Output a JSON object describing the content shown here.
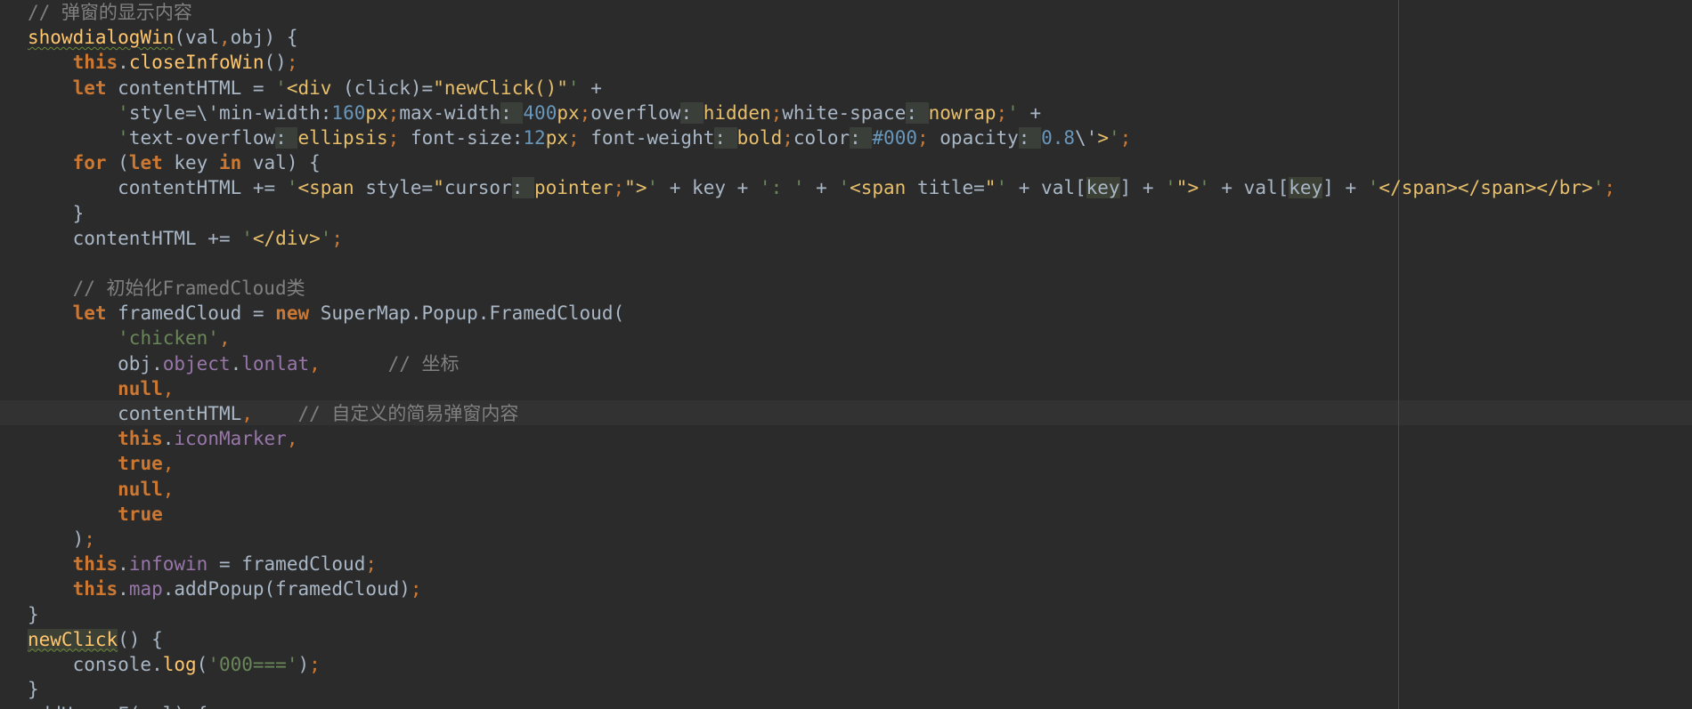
{
  "editor": {
    "lines": [
      {
        "indent": "",
        "segments": [
          {
            "t": "// 弹窗的显示内容",
            "c": "cmt"
          }
        ]
      },
      {
        "indent": "",
        "segments": [
          {
            "t": "showdialogWin",
            "c": "fn squig"
          },
          {
            "t": "(val",
            "c": "plain"
          },
          {
            "t": ",",
            "c": "pun"
          },
          {
            "t": "obj) {",
            "c": "plain"
          }
        ]
      },
      {
        "indent": "    ",
        "segments": [
          {
            "t": "this",
            "c": "kw"
          },
          {
            "t": ".",
            "c": "plain"
          },
          {
            "t": "closeInfoWin",
            "c": "fn"
          },
          {
            "t": "()",
            "c": "plain"
          },
          {
            "t": ";",
            "c": "pun"
          }
        ]
      },
      {
        "indent": "    ",
        "segments": [
          {
            "t": "let ",
            "c": "kw"
          },
          {
            "t": "contentHTML = ",
            "c": "plain"
          },
          {
            "t": "'",
            "c": "str"
          },
          {
            "t": "<div ",
            "c": "strb"
          },
          {
            "t": "(click)=",
            "c": "plain"
          },
          {
            "t": "\"newClick()\"",
            "c": "strb"
          },
          {
            "t": "' ",
            "c": "str"
          },
          {
            "t": "+",
            "c": "plain"
          }
        ]
      },
      {
        "indent": "        ",
        "segments": [
          {
            "t": "'",
            "c": "str"
          },
          {
            "t": "style=\\'",
            "c": "plain"
          },
          {
            "t": "min-width",
            "c": "plain"
          },
          {
            "t": ":",
            "c": "plain"
          },
          {
            "t": "160",
            "c": "num"
          },
          {
            "t": "px",
            "c": "strb"
          },
          {
            "t": ";",
            "c": "pun"
          },
          {
            "t": "max-width",
            "c": "plain"
          },
          {
            "t": ": ",
            "c": "plain hl"
          },
          {
            "t": "400",
            "c": "num"
          },
          {
            "t": "px",
            "c": "strb"
          },
          {
            "t": ";",
            "c": "pun"
          },
          {
            "t": "overflow",
            "c": "plain"
          },
          {
            "t": ": ",
            "c": "plain hl"
          },
          {
            "t": "hidden",
            "c": "strb"
          },
          {
            "t": ";",
            "c": "pun"
          },
          {
            "t": "white-space",
            "c": "plain"
          },
          {
            "t": ": ",
            "c": "plain hl"
          },
          {
            "t": "nowrap",
            "c": "strb"
          },
          {
            "t": ";",
            "c": "pun"
          },
          {
            "t": "' ",
            "c": "str"
          },
          {
            "t": "+",
            "c": "plain"
          }
        ]
      },
      {
        "indent": "        ",
        "segments": [
          {
            "t": "'",
            "c": "str"
          },
          {
            "t": "text-overflow",
            "c": "plain"
          },
          {
            "t": ": ",
            "c": "plain hl"
          },
          {
            "t": "ellipsis",
            "c": "strb"
          },
          {
            "t": "; ",
            "c": "pun"
          },
          {
            "t": "font-size",
            "c": "plain"
          },
          {
            "t": ":",
            "c": "plain"
          },
          {
            "t": "12",
            "c": "num"
          },
          {
            "t": "px",
            "c": "strb"
          },
          {
            "t": "; ",
            "c": "pun"
          },
          {
            "t": "font-weight",
            "c": "plain"
          },
          {
            "t": ": ",
            "c": "plain hl"
          },
          {
            "t": "bold",
            "c": "strb"
          },
          {
            "t": ";",
            "c": "pun"
          },
          {
            "t": "color",
            "c": "plain"
          },
          {
            "t": ": ",
            "c": "plain hl"
          },
          {
            "t": "#000",
            "c": "num"
          },
          {
            "t": "; ",
            "c": "pun"
          },
          {
            "t": "opacity",
            "c": "plain"
          },
          {
            "t": ": ",
            "c": "plain hl"
          },
          {
            "t": "0.8",
            "c": "num"
          },
          {
            "t": "\\'",
            "c": "plain"
          },
          {
            "t": ">",
            "c": "strb"
          },
          {
            "t": "'",
            "c": "str"
          },
          {
            "t": ";",
            "c": "pun"
          }
        ]
      },
      {
        "indent": "    ",
        "segments": [
          {
            "t": "for ",
            "c": "kw"
          },
          {
            "t": "(",
            "c": "plain"
          },
          {
            "t": "let ",
            "c": "kw"
          },
          {
            "t": "key ",
            "c": "plain"
          },
          {
            "t": "in ",
            "c": "kw"
          },
          {
            "t": "val) {",
            "c": "plain"
          }
        ]
      },
      {
        "indent": "        ",
        "segments": [
          {
            "t": "contentHTML += ",
            "c": "plain"
          },
          {
            "t": "'",
            "c": "str"
          },
          {
            "t": "<span ",
            "c": "strb"
          },
          {
            "t": "style=",
            "c": "plain"
          },
          {
            "t": "\"",
            "c": "strb"
          },
          {
            "t": "cursor",
            "c": "plain"
          },
          {
            "t": ": ",
            "c": "plain hl"
          },
          {
            "t": "pointer",
            "c": "strb"
          },
          {
            "t": ";",
            "c": "pun"
          },
          {
            "t": "\">",
            "c": "strb"
          },
          {
            "t": "' ",
            "c": "str"
          },
          {
            "t": "+ key + ",
            "c": "plain"
          },
          {
            "t": "': '",
            "c": "str"
          },
          {
            "t": " + ",
            "c": "plain"
          },
          {
            "t": "'",
            "c": "str"
          },
          {
            "t": "<span ",
            "c": "strb"
          },
          {
            "t": "title=",
            "c": "plain"
          },
          {
            "t": "\"",
            "c": "strb"
          },
          {
            "t": "' ",
            "c": "str"
          },
          {
            "t": "+ val[",
            "c": "plain"
          },
          {
            "t": "key",
            "c": "plain usage"
          },
          {
            "t": "] + ",
            "c": "plain"
          },
          {
            "t": "'",
            "c": "str"
          },
          {
            "t": "\">",
            "c": "strb"
          },
          {
            "t": "' ",
            "c": "str"
          },
          {
            "t": "+ val[",
            "c": "plain"
          },
          {
            "t": "key",
            "c": "plain usage"
          },
          {
            "t": "] + ",
            "c": "plain"
          },
          {
            "t": "'",
            "c": "str"
          },
          {
            "t": "</span></span></br>",
            "c": "strb"
          },
          {
            "t": "'",
            "c": "str"
          },
          {
            "t": ";",
            "c": "pun"
          }
        ]
      },
      {
        "indent": "    ",
        "segments": [
          {
            "t": "}",
            "c": "plain"
          }
        ]
      },
      {
        "indent": "    ",
        "segments": [
          {
            "t": "contentHTML += ",
            "c": "plain"
          },
          {
            "t": "'",
            "c": "str"
          },
          {
            "t": "</div>",
            "c": "strb"
          },
          {
            "t": "'",
            "c": "str"
          },
          {
            "t": ";",
            "c": "pun"
          }
        ]
      },
      {
        "indent": "",
        "segments": []
      },
      {
        "indent": "    ",
        "segments": [
          {
            "t": "// 初始化FramedCloud类",
            "c": "cmt"
          }
        ]
      },
      {
        "indent": "    ",
        "segments": [
          {
            "t": "let ",
            "c": "kw"
          },
          {
            "t": "framedCloud = ",
            "c": "plain"
          },
          {
            "t": "new ",
            "c": "kw"
          },
          {
            "t": "SuperMap.Popup.FramedCloud(",
            "c": "plain"
          }
        ]
      },
      {
        "indent": "        ",
        "segments": [
          {
            "t": "'chicken'",
            "c": "str"
          },
          {
            "t": ",",
            "c": "pun"
          }
        ]
      },
      {
        "indent": "        ",
        "segments": [
          {
            "t": "obj.",
            "c": "plain"
          },
          {
            "t": "object",
            "c": "prop"
          },
          {
            "t": ".",
            "c": "plain"
          },
          {
            "t": "lonlat",
            "c": "prop"
          },
          {
            "t": ",      ",
            "c": "pun"
          },
          {
            "t": "// 坐标",
            "c": "cmt"
          }
        ]
      },
      {
        "indent": "        ",
        "segments": [
          {
            "t": "null",
            "c": "kw"
          },
          {
            "t": ",",
            "c": "pun"
          }
        ]
      },
      {
        "indent": "        ",
        "segments": [
          {
            "t": "contentHTML",
            "c": "plain"
          },
          {
            "t": ",    ",
            "c": "pun"
          },
          {
            "t": "// 自定义的简易弹窗内容",
            "c": "cmt"
          }
        ]
      },
      {
        "indent": "        ",
        "segments": [
          {
            "t": "this",
            "c": "kw"
          },
          {
            "t": ".",
            "c": "plain"
          },
          {
            "t": "iconMarker",
            "c": "prop"
          },
          {
            "t": ",",
            "c": "pun"
          }
        ]
      },
      {
        "indent": "        ",
        "segments": [
          {
            "t": "true",
            "c": "kw"
          },
          {
            "t": ",",
            "c": "pun"
          }
        ]
      },
      {
        "indent": "        ",
        "segments": [
          {
            "t": "null",
            "c": "kw"
          },
          {
            "t": ",",
            "c": "pun"
          }
        ]
      },
      {
        "indent": "        ",
        "segments": [
          {
            "t": "true",
            "c": "kw"
          }
        ]
      },
      {
        "indent": "    ",
        "segments": [
          {
            "t": ")",
            "c": "plain"
          },
          {
            "t": ";",
            "c": "pun"
          }
        ]
      },
      {
        "indent": "    ",
        "segments": [
          {
            "t": "this",
            "c": "kw"
          },
          {
            "t": ".",
            "c": "plain"
          },
          {
            "t": "infowin",
            "c": "prop"
          },
          {
            "t": " = framedCloud",
            "c": "plain"
          },
          {
            "t": ";",
            "c": "pun"
          }
        ]
      },
      {
        "indent": "    ",
        "segments": [
          {
            "t": "this",
            "c": "kw"
          },
          {
            "t": ".",
            "c": "plain"
          },
          {
            "t": "map",
            "c": "prop"
          },
          {
            "t": ".addPopup(framedCloud)",
            "c": "plain"
          },
          {
            "t": ";",
            "c": "pun"
          }
        ]
      },
      {
        "indent": "",
        "segments": [
          {
            "t": "}",
            "c": "plain"
          }
        ]
      },
      {
        "indent": "",
        "segments": [
          {
            "t": "newClick",
            "c": "fn usage squig"
          },
          {
            "t": "() {",
            "c": "plain"
          }
        ]
      },
      {
        "indent": "    ",
        "segments": [
          {
            "t": "console.",
            "c": "plain"
          },
          {
            "t": "log",
            "c": "fn"
          },
          {
            "t": "(",
            "c": "plain"
          },
          {
            "t": "'000==='",
            "c": "str"
          },
          {
            "t": ")",
            "c": "plain"
          },
          {
            "t": ";",
            "c": "pun"
          }
        ]
      },
      {
        "indent": "",
        "segments": [
          {
            "t": "}",
            "c": "plain"
          }
        ]
      },
      {
        "indent": "",
        "segments": [
          {
            "t": "addHoverF(val) {",
            "c": "plain"
          }
        ]
      }
    ]
  }
}
